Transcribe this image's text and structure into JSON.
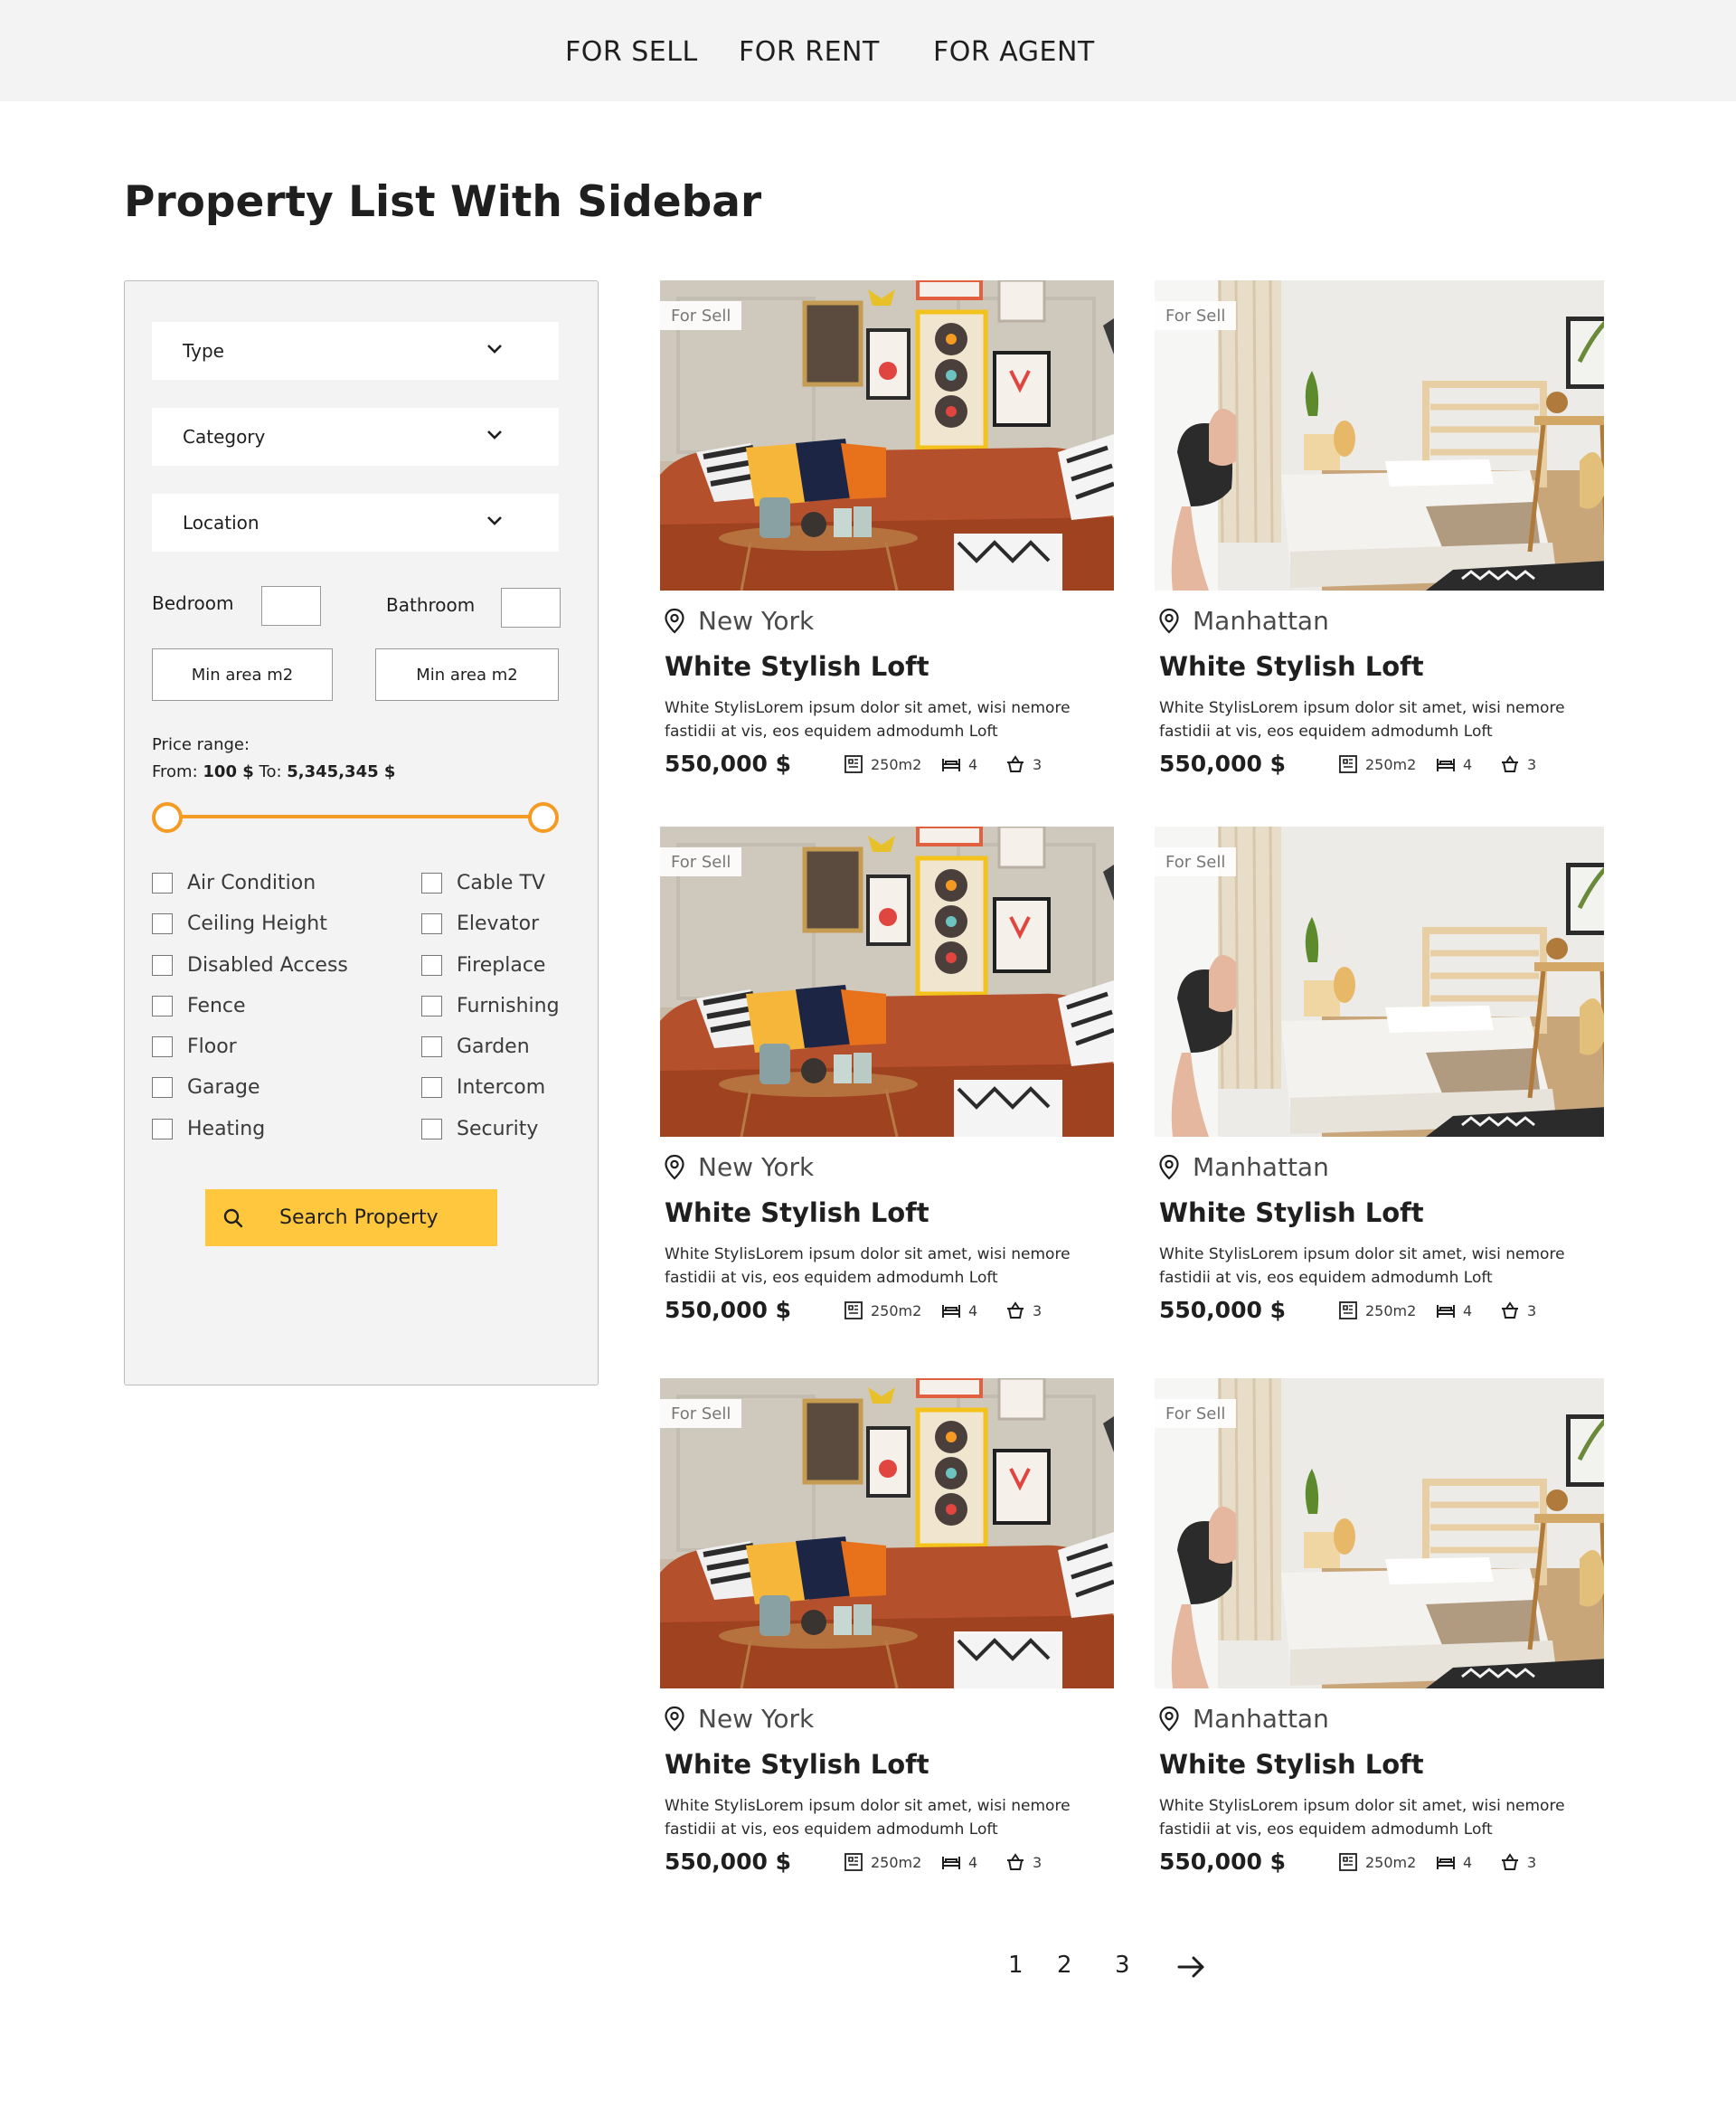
{
  "nav": {
    "items": [
      "FOR SELL",
      "FOR RENT",
      "FOR AGENT"
    ]
  },
  "page_title": "Property List With Sidebar",
  "filters": {
    "type_label": "Type",
    "category_label": "Category",
    "location_label": "Location",
    "bedroom_label": "Bedroom",
    "bathroom_label": "Bathroom",
    "min_area_placeholder_1": "Min area m2",
    "min_area_placeholder_2": "Min area m2",
    "price_range_label": "Price range:",
    "from_label": "From:",
    "from_value": "100 $",
    "to_label": "To:",
    "to_value": "5,345,345 $",
    "amenities_left": [
      "Air Condition",
      "Ceiling Height",
      "Disabled Access",
      "Fence",
      "Floor",
      "Garage",
      "Heating"
    ],
    "amenities_right": [
      "Cable TV",
      "Elevator",
      "Fireplace",
      "Furnishing",
      "Garden",
      "Intercom",
      "Security"
    ],
    "search_button": "Search Property"
  },
  "listings": [
    {
      "badge": "For Sell",
      "location": "New York",
      "title": "White Stylish Loft",
      "description": "White StylisLorem ipsum dolor sit amet, wisi nemore fastidii at vis, eos equidem admodumh Loft",
      "price": "550,000 $",
      "area": "250m2",
      "beds": "4",
      "baths": "3",
      "image": "living-room-photo"
    },
    {
      "badge": "For Sell",
      "location": "Manhattan",
      "title": "White Stylish Loft",
      "description": "White StylisLorem ipsum dolor sit amet, wisi nemore fastidii at vis, eos equidem admodumh Loft",
      "price": "550,000 $",
      "area": "250m2",
      "beds": "4",
      "baths": "3",
      "image": "bedroom-photo"
    },
    {
      "badge": "For Sell",
      "location": "New York",
      "title": "White Stylish Loft",
      "description": "White StylisLorem ipsum dolor sit amet, wisi nemore fastidii at vis, eos equidem admodumh Loft",
      "price": "550,000 $",
      "area": "250m2",
      "beds": "4",
      "baths": "3",
      "image": "living-room-photo"
    },
    {
      "badge": "For Sell",
      "location": "Manhattan",
      "title": "White Stylish Loft",
      "description": "White StylisLorem ipsum dolor sit amet, wisi nemore fastidii at vis, eos equidem admodumh Loft",
      "price": "550,000 $",
      "area": "250m2",
      "beds": "4",
      "baths": "3",
      "image": "bedroom-photo"
    },
    {
      "badge": "For Sell",
      "location": "New York",
      "title": "White Stylish Loft",
      "description": "White StylisLorem ipsum dolor sit amet, wisi nemore fastidii at vis, eos equidem admodumh Loft",
      "price": "550,000 $",
      "area": "250m2",
      "beds": "4",
      "baths": "3",
      "image": "living-room-photo"
    },
    {
      "badge": "For Sell",
      "location": "Manhattan",
      "title": "White Stylish Loft",
      "description": "White StylisLorem ipsum dolor sit amet, wisi nemore fastidii at vis, eos equidem admodumh Loft",
      "price": "550,000 $",
      "area": "250m2",
      "beds": "4",
      "baths": "3",
      "image": "bedroom-photo"
    }
  ],
  "pagination": {
    "pages": [
      "1",
      "2",
      "3"
    ],
    "next_icon": "arrow-right-icon"
  },
  "colors": {
    "accent": "#f59a23",
    "button": "#fec73e",
    "sidebar_bg": "#f3f3f3",
    "nav_bg": "#f3f3f3"
  }
}
